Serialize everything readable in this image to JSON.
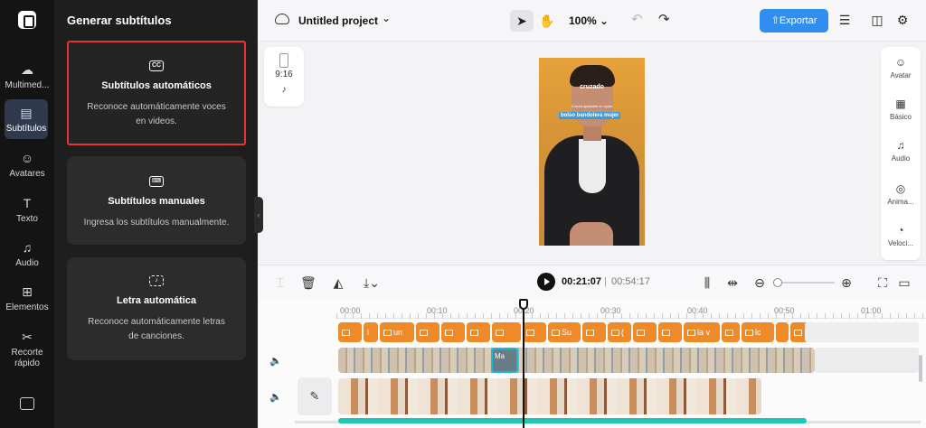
{
  "sidebar": {
    "items": [
      {
        "label": "Multimed...",
        "icon": "upload-cloud-icon"
      },
      {
        "label": "Subtítulos",
        "icon": "subtitles-icon"
      },
      {
        "label": "Avatares",
        "icon": "avatar-icon"
      },
      {
        "label": "Texto",
        "icon": "text-icon"
      },
      {
        "label": "Audio",
        "icon": "music-note-icon"
      },
      {
        "label": "Elementos",
        "icon": "elements-icon"
      },
      {
        "label": "Recorte rápido",
        "icon": "quick-cut-icon"
      }
    ]
  },
  "panel": {
    "title": "Generar subtítulos",
    "cards": [
      {
        "title": "Subtítulos automáticos",
        "desc": "Reconoce automáticamente voces en videos."
      },
      {
        "title": "Subtítulos manuales",
        "desc": "Ingresa los subtítulos manualmente."
      },
      {
        "title": "Letra automática",
        "desc": "Reconoce automáticamente letras de canciones."
      }
    ]
  },
  "topbar": {
    "project_name": "Untitled project",
    "zoom": "100%",
    "export_label": "Exportar"
  },
  "format": {
    "ratio": "9:16"
  },
  "preview": {
    "subtitle_top": "cruzado",
    "subtitle_mid": "Correa ajustable en nylon",
    "subtitle_highlight": "bolso bandolera mujer"
  },
  "right_tools": [
    {
      "label": "Avatar"
    },
    {
      "label": "Básico"
    },
    {
      "label": "Audio"
    },
    {
      "label": "Anima..."
    },
    {
      "label": "Veloci..."
    }
  ],
  "timeline": {
    "current_time": "00:21:07",
    "separator": "|",
    "total_time": "00:54:17",
    "ticks": [
      "00:00",
      "00:10",
      "00:20",
      "00:30",
      "00:40",
      "00:50",
      "01:00"
    ],
    "subtitle_chips": [
      "",
      "l",
      "un",
      "",
      "",
      "",
      "Su",
      "",
      "(",
      "",
      "",
      "la v",
      "",
      "lc",
      "",
      ""
    ],
    "selected_clip_label": "Ma"
  },
  "colors": {
    "accent": "#2f8ef0",
    "selection": "#e8313a",
    "subtitle_chip": "#f08a28",
    "active_rail": "#2f3a4e"
  }
}
